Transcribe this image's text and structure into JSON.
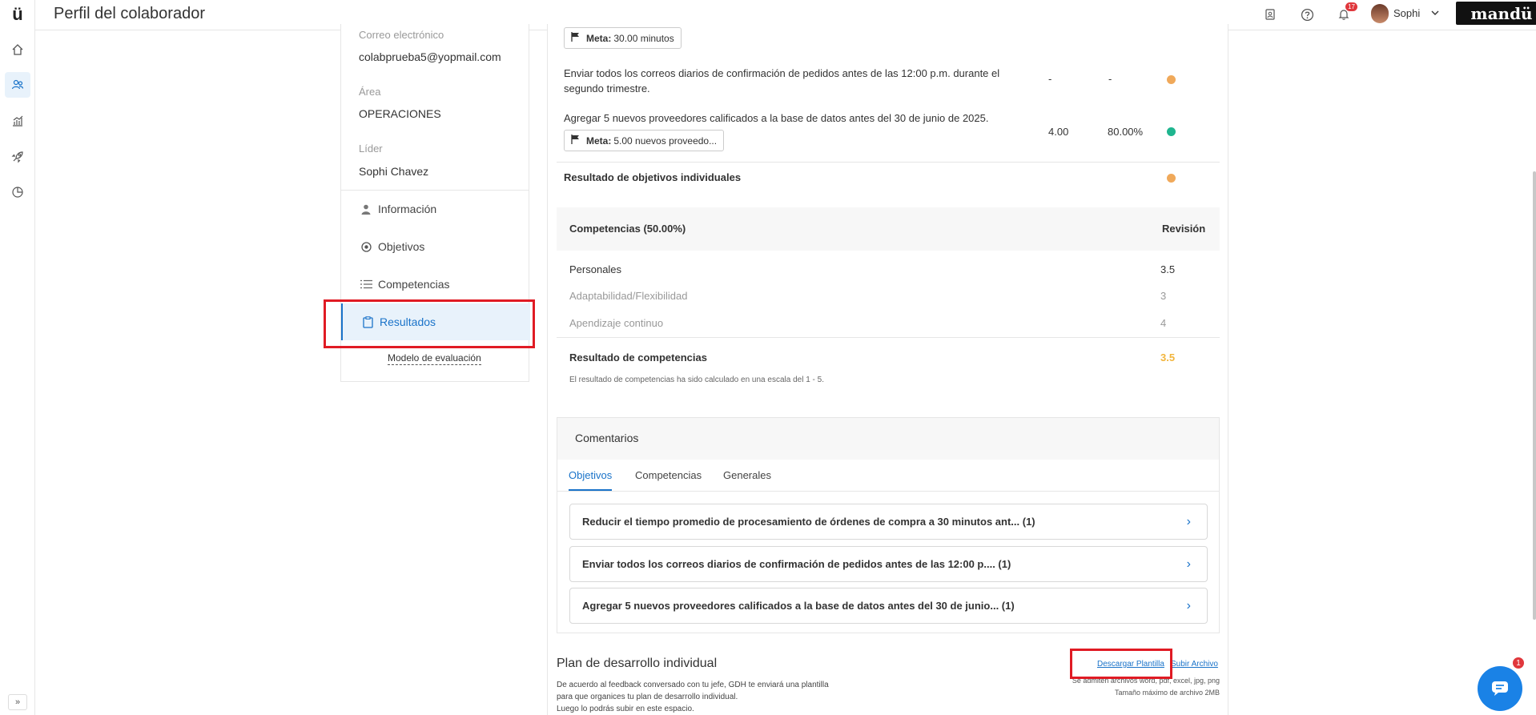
{
  "app": {
    "logo": "ü",
    "title": "Perfil del colaborador",
    "brand": "mandü"
  },
  "topbar": {
    "notifications_count": "17",
    "user_name": "Sophi"
  },
  "rail": {
    "items": [
      "home-icon",
      "people-icon",
      "chart-icon",
      "rocket-icon",
      "pie-icon"
    ]
  },
  "profile": {
    "email_label": "Correo electrónico",
    "email": "colabprueba5@yopmail.com",
    "area_label": "Área",
    "area": "OPERACIONES",
    "leader_label": "Líder",
    "leader": "Sophi Chavez",
    "nav": [
      {
        "label": "Información",
        "icon": "person-icon"
      },
      {
        "label": "Objetivos",
        "icon": "target-icon"
      },
      {
        "label": "Competencias",
        "icon": "list-icon"
      },
      {
        "label": "Resultados",
        "icon": "clipboard-icon"
      }
    ],
    "model_link": "Modelo de evaluación"
  },
  "objectives": {
    "goal1_meta_label": "Meta:",
    "goal1_meta": "30.00 minutos",
    "goal2_text": "Enviar todos los correos diarios de confirmación de pedidos antes de las 12:00 p.m. durante el segundo trimestre.",
    "goal2_value": "-",
    "goal2_percent": "-",
    "goal3_text": "Agregar 5 nuevos proveedores calificados a la base de datos antes del 30 de junio de 2025.",
    "goal3_meta_label": "Meta:",
    "goal3_meta": "5.00 nuevos proveedo...",
    "goal3_value": "4.00",
    "goal3_percent": "80.00%",
    "result_label": "Resultado de objetivos individuales",
    "colors": {
      "orange": "#f0a95a",
      "green": "#1fb58f"
    }
  },
  "competencies": {
    "header": "Competencias (50.00%)",
    "review_label": "Revisión",
    "rows": [
      {
        "label": "Personales",
        "value": "3.5"
      },
      {
        "label": "Adaptabilidad/Flexibilidad",
        "value": "3"
      },
      {
        "label": "Apendizaje continuo",
        "value": "4"
      }
    ],
    "result_label": "Resultado de competencias",
    "result_value": "3.5",
    "scale_note": "El resultado de competencias ha sido calculado en una escala del 1 - 5."
  },
  "comments": {
    "title": "Comentarios",
    "tabs": [
      "Objetivos",
      "Competencias",
      "Generales"
    ],
    "items": [
      "Reducir el tiempo promedio de procesamiento de órdenes de compra a 30 minutos ant... (1)",
      "Enviar todos los correos diarios de confirmación de pedidos antes de las 12:00 p.... (1)",
      "Agregar 5 nuevos proveedores calificados a la base de datos antes del 30 de junio... (1)"
    ]
  },
  "plan": {
    "title": "Plan de desarrollo individual",
    "desc_line1": "De acuerdo al feedback conversado con tu jefe, GDH te enviará una plantilla",
    "desc_line2": "para que organices tu plan de desarrollo individual.",
    "desc_line3": "Luego lo podrás subir en este espacio.",
    "download_link": "Descargar Plantilla",
    "upload_link": "Subir Archivo",
    "formats_note": "Se admiten archivos word, pdf, excel, jpg, png",
    "size_note": "Tamaño máximo de archivo 2MB"
  },
  "chat": {
    "badge": "1"
  }
}
